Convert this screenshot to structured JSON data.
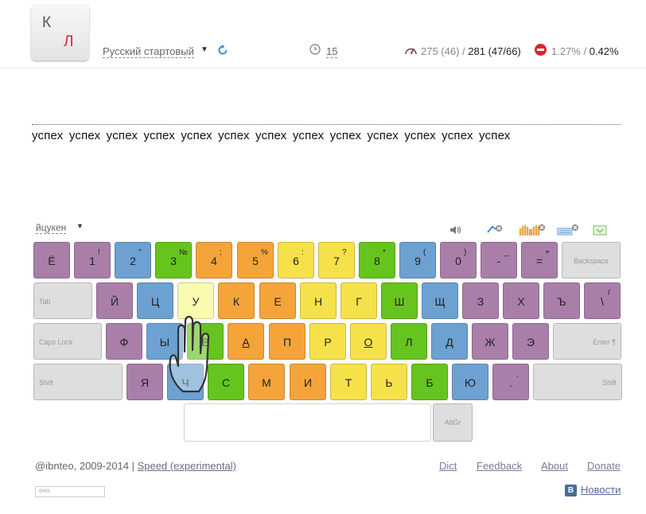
{
  "header": {
    "logo_letter_1": "К",
    "logo_letter_2": "Л",
    "lesson": "Русский стартовый",
    "time": "15",
    "speed_current": "275 (46) / ",
    "speed_best": "281 (47/66)",
    "errors_current": "1.27% / ",
    "errors_best": "0.42%"
  },
  "text": {
    "line": "успех успех успех успех успех успех успех успех успех успех успех успех успех"
  },
  "keyboard": {
    "layout": "йцукен",
    "rows": [
      [
        {
          "m": "Ё",
          "s": "",
          "c": "pur",
          "w": 46
        },
        {
          "m": "1",
          "s": "!",
          "c": "pur",
          "w": 46
        },
        {
          "m": "2",
          "s": "\"",
          "c": "blu",
          "w": 46
        },
        {
          "m": "3",
          "s": "№",
          "c": "grn",
          "w": 46
        },
        {
          "m": "4",
          "s": ";",
          "c": "org",
          "w": 46
        },
        {
          "m": "5",
          "s": "%",
          "c": "org",
          "w": 46
        },
        {
          "m": "6",
          "s": ":",
          "c": "yel",
          "w": 46
        },
        {
          "m": "7",
          "s": "?",
          "c": "yel",
          "w": 46
        },
        {
          "m": "8",
          "s": "*",
          "c": "grn",
          "w": 46
        },
        {
          "m": "9",
          "s": "(",
          "c": "blu",
          "w": 46
        },
        {
          "m": "0",
          "s": ")",
          "c": "pur",
          "w": 46
        },
        {
          "m": "-",
          "s": "_",
          "c": "pur",
          "w": 46
        },
        {
          "m": "=",
          "s": "+",
          "c": "pur",
          "w": 46
        },
        {
          "m": "Backspace",
          "s": "",
          "c": "gry",
          "w": 74,
          "fn": "center"
        }
      ],
      [
        {
          "m": "Tab",
          "s": "",
          "c": "gry",
          "w": 74,
          "fn": "left"
        },
        {
          "m": "Й",
          "s": "",
          "c": "pur",
          "w": 46
        },
        {
          "m": "Ц",
          "s": "",
          "c": "blu",
          "w": 46
        },
        {
          "m": "У",
          "s": "",
          "c": "lyl",
          "w": 46
        },
        {
          "m": "К",
          "s": "",
          "c": "org",
          "w": 46
        },
        {
          "m": "Е",
          "s": "",
          "c": "org",
          "w": 46
        },
        {
          "m": "Н",
          "s": "",
          "c": "yel",
          "w": 46
        },
        {
          "m": "Г",
          "s": "",
          "c": "yel",
          "w": 46
        },
        {
          "m": "Ш",
          "s": "",
          "c": "grn",
          "w": 46
        },
        {
          "m": "Щ",
          "s": "",
          "c": "blu",
          "w": 46
        },
        {
          "m": "З",
          "s": "",
          "c": "pur",
          "w": 46
        },
        {
          "m": "Х",
          "s": "",
          "c": "pur",
          "w": 46
        },
        {
          "m": "Ъ",
          "s": "",
          "c": "pur",
          "w": 46
        },
        {
          "m": "\\",
          "s": "/",
          "c": "pur",
          "w": 46
        }
      ],
      [
        {
          "m": "Caps Lock",
          "s": "",
          "c": "gry",
          "w": 86,
          "fn": "left"
        },
        {
          "m": "Ф",
          "s": "",
          "c": "pur",
          "w": 46
        },
        {
          "m": "Ы",
          "s": "",
          "c": "blu",
          "w": 46
        },
        {
          "m": "В",
          "s": "",
          "c": "grn",
          "w": 46
        },
        {
          "m": "А",
          "s": "",
          "c": "org",
          "w": 46,
          "home": true
        },
        {
          "m": "П",
          "s": "",
          "c": "org",
          "w": 46
        },
        {
          "m": "Р",
          "s": "",
          "c": "yel",
          "w": 46
        },
        {
          "m": "О",
          "s": "",
          "c": "yel",
          "w": 46,
          "home": true
        },
        {
          "m": "Л",
          "s": "",
          "c": "grn",
          "w": 46
        },
        {
          "m": "Д",
          "s": "",
          "c": "blu",
          "w": 46
        },
        {
          "m": "Ж",
          "s": "",
          "c": "pur",
          "w": 46
        },
        {
          "m": "Э",
          "s": "",
          "c": "pur",
          "w": 46
        },
        {
          "m": "Enter ¶",
          "s": "",
          "c": "gry",
          "w": 86,
          "fn": "right"
        }
      ],
      [
        {
          "m": "Shift",
          "s": "",
          "c": "gry",
          "w": 112,
          "fn": "left"
        },
        {
          "m": "Я",
          "s": "",
          "c": "pur",
          "w": 46
        },
        {
          "m": "Ч",
          "s": "",
          "c": "blu",
          "w": 46
        },
        {
          "m": "С",
          "s": "",
          "c": "grn",
          "w": 46
        },
        {
          "m": "М",
          "s": "",
          "c": "org",
          "w": 46
        },
        {
          "m": "И",
          "s": "",
          "c": "org",
          "w": 46
        },
        {
          "m": "Т",
          "s": "",
          "c": "yel",
          "w": 46
        },
        {
          "m": "Ь",
          "s": "",
          "c": "yel",
          "w": 46
        },
        {
          "m": "Б",
          "s": "",
          "c": "grn",
          "w": 46
        },
        {
          "m": "Ю",
          "s": "",
          "c": "blu",
          "w": 46
        },
        {
          "m": ".",
          "s": ",",
          "c": "pur",
          "w": 46
        },
        {
          "m": "Shift",
          "s": "",
          "c": "gry",
          "w": 112,
          "fn": "right"
        }
      ]
    ],
    "altgr": "AltGr"
  },
  "footer": {
    "author": "@ibnteo",
    "years": ", 2009-2014 | ",
    "speed_link": "Speed (experimental)",
    "dict": "Dict",
    "feedback": "Feedback",
    "about": "About",
    "donate": "Donate",
    "ad": "eeo",
    "vk": "B",
    "news": "Новости"
  }
}
